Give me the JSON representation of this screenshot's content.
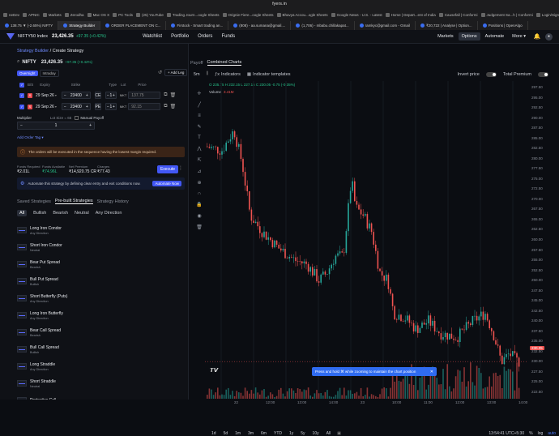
{
  "browser": {
    "url": "fyers.in",
    "bookmarks": [
      "neDev",
      "APNIC",
      "Markets",
      "Zerodha",
      "Mac OS X",
      "PC Tools",
      "(25) YouTube",
      "Trading Journ...oogle Sheets",
      "Orignie Fiere...oogle Sheets",
      "Bhavya Accou...ogle Sheets",
      "Google News - U.S. - Latest",
      "Home | Depart...ent of India",
      "Causefall | Conformi",
      "Judgement Sa...h | Conformi",
      "Login/Sign U..."
    ],
    "tabs": [
      {
        "label": "138.75 ▼ (-2.65%) NIFTY",
        "active": false
      },
      {
        "label": "Strategy Builder",
        "active": true
      },
      {
        "label": "ORDER PLACEMENT ON C...",
        "active": false
      },
      {
        "label": "Firstock - Smart trading an...",
        "active": false
      },
      {
        "label": "(808) - aa.sumana@gmail....",
        "active": false
      },
      {
        "label": "(1,706) - mbabu.chillakapat...",
        "active": false
      },
      {
        "label": "ramkyc@gmail.com - Gmail",
        "active": false
      },
      {
        "label": "₹20,722 | Analyse | Option...",
        "active": false
      },
      {
        "label": "Positions | OpenAlgo",
        "active": false
      }
    ]
  },
  "header": {
    "index_name": "NIFTY50 Index",
    "price": "23,426.35",
    "change": "+97.35 (+0.42%)",
    "nav": [
      "Watchlist",
      "Portfolio",
      "Orders",
      "Funds"
    ],
    "right_nav": [
      "Markets",
      "Options",
      "Automate",
      "More ▾"
    ],
    "selected_right": "Options"
  },
  "left": {
    "breadcrumb_a": "Strategy Builder",
    "breadcrumb_sep": "/",
    "breadcrumb_b": "Create Strategy",
    "symbol": "NIFTY",
    "symbol_price": "23,426.35",
    "symbol_change": "+97.35 (+0.42%)",
    "mode_tabs": [
      "Overnight",
      "Intraday"
    ],
    "add_leg": "+ Add Leg",
    "table_headers": [
      "B/S",
      "Expiry",
      "Strike",
      "Type",
      "Lot",
      "Price"
    ],
    "legs": [
      {
        "side": "S",
        "expiry": "29 Sep 26",
        "strike": "23400",
        "type": "CE",
        "lot": "1",
        "order": "MKT",
        "price": "137.75"
      },
      {
        "side": "S",
        "expiry": "29 Sep 26",
        "strike": "23400",
        "type": "PE",
        "lot": "1",
        "order": "MKT",
        "price": "92.15"
      }
    ],
    "multiplier_label": "Multiplier",
    "lot_size": "Lot Size = 65",
    "manual_payoff": "Manual Payoff",
    "multiplier_value": "1",
    "add_order_tag": "Add Order Tag ▾",
    "warning": "The orders will be executed in the sequence having the lowest margin required.",
    "funds": [
      {
        "label": "Funds Required",
        "value": "₹2.01L"
      },
      {
        "label": "Funds Available",
        "value": "₹74.96L"
      },
      {
        "label": "Net Premium",
        "value": "₹14,920.75 CR"
      },
      {
        "label": "Charges",
        "value": "₹77.43"
      }
    ],
    "execute": "Execute",
    "automate_text": "Automate this strategy by defining clear entry and exit conditions now.",
    "automate_btn": "Automate Now",
    "strategy_tabs": [
      "Saved Strategies",
      "Pre-built Strategies",
      "Strategy History"
    ],
    "active_strategy_tab": "Pre-built Strategies",
    "filters": [
      "All",
      "Bullish",
      "Bearish",
      "Neutral",
      "Any Direction"
    ],
    "strategies": [
      {
        "name": "Long Iron Condor",
        "dir": "Any Direction"
      },
      {
        "name": "Short Iron Condor",
        "dir": "Neutral"
      },
      {
        "name": "Bear Put Spread",
        "dir": "Bearish"
      },
      {
        "name": "Bull Put Spread",
        "dir": "Bullish"
      },
      {
        "name": "Short Butterfly (Puts)",
        "dir": "Any Direction"
      },
      {
        "name": "Long Iron Butterfly",
        "dir": "Any Direction"
      },
      {
        "name": "Bear Call Spread",
        "dir": "Bearish"
      },
      {
        "name": "Bull Call Spread",
        "dir": "Bullish"
      },
      {
        "name": "Long Straddle",
        "dir": "Any Direction"
      },
      {
        "name": "Short Straddle",
        "dir": "Neutral"
      },
      {
        "name": "Protective Call",
        "dir": ""
      }
    ]
  },
  "right": {
    "tabs": [
      "Payoff",
      "Combined Charts"
    ],
    "active_tab": "Combined Charts",
    "interval": "5m",
    "indicators": "Indicators",
    "indicator_templates": "Indicator templates",
    "invert_price": "Invert price",
    "total_premium": "Total Premium",
    "ohlc": "O 235.75 H 232.15 L 227.15 C 230.05 -0.75 (-0.35%)",
    "volume_label": "Volume",
    "volume_value": "3.41M",
    "yaxis": [
      "297.50",
      "295.00",
      "292.50",
      "290.00",
      "287.50",
      "285.00",
      "282.50",
      "280.00",
      "277.50",
      "275.00",
      "272.50",
      "270.00",
      "267.50",
      "265.00",
      "262.50",
      "260.00",
      "257.50",
      "255.00",
      "252.50",
      "250.00",
      "247.50",
      "245.00",
      "242.50",
      "240.00",
      "237.50",
      "235.00",
      "232.50",
      "230.00",
      "227.50",
      "225.00",
      "222.50"
    ],
    "current_price": "230.05",
    "xaxis": [
      "22",
      "12:00",
      "13:00",
      "14:00",
      "23",
      "10:00",
      "11:00",
      "12:00",
      "13:00",
      "14:00"
    ],
    "timeframes": [
      "1d",
      "5d",
      "1m",
      "3m",
      "6m",
      "YTD",
      "1y",
      "5y",
      "10y",
      "All"
    ],
    "clock": "13:54:41 UTC+5:30",
    "scale_opts": [
      "%",
      "log",
      "auto"
    ],
    "toast": "Press and hold ⌘ while zooming to maintain the chart position"
  },
  "colors": {
    "accent": "#4257f5",
    "up": "#26a69a",
    "down": "#ef5350",
    "bg": "#0b0d12"
  }
}
